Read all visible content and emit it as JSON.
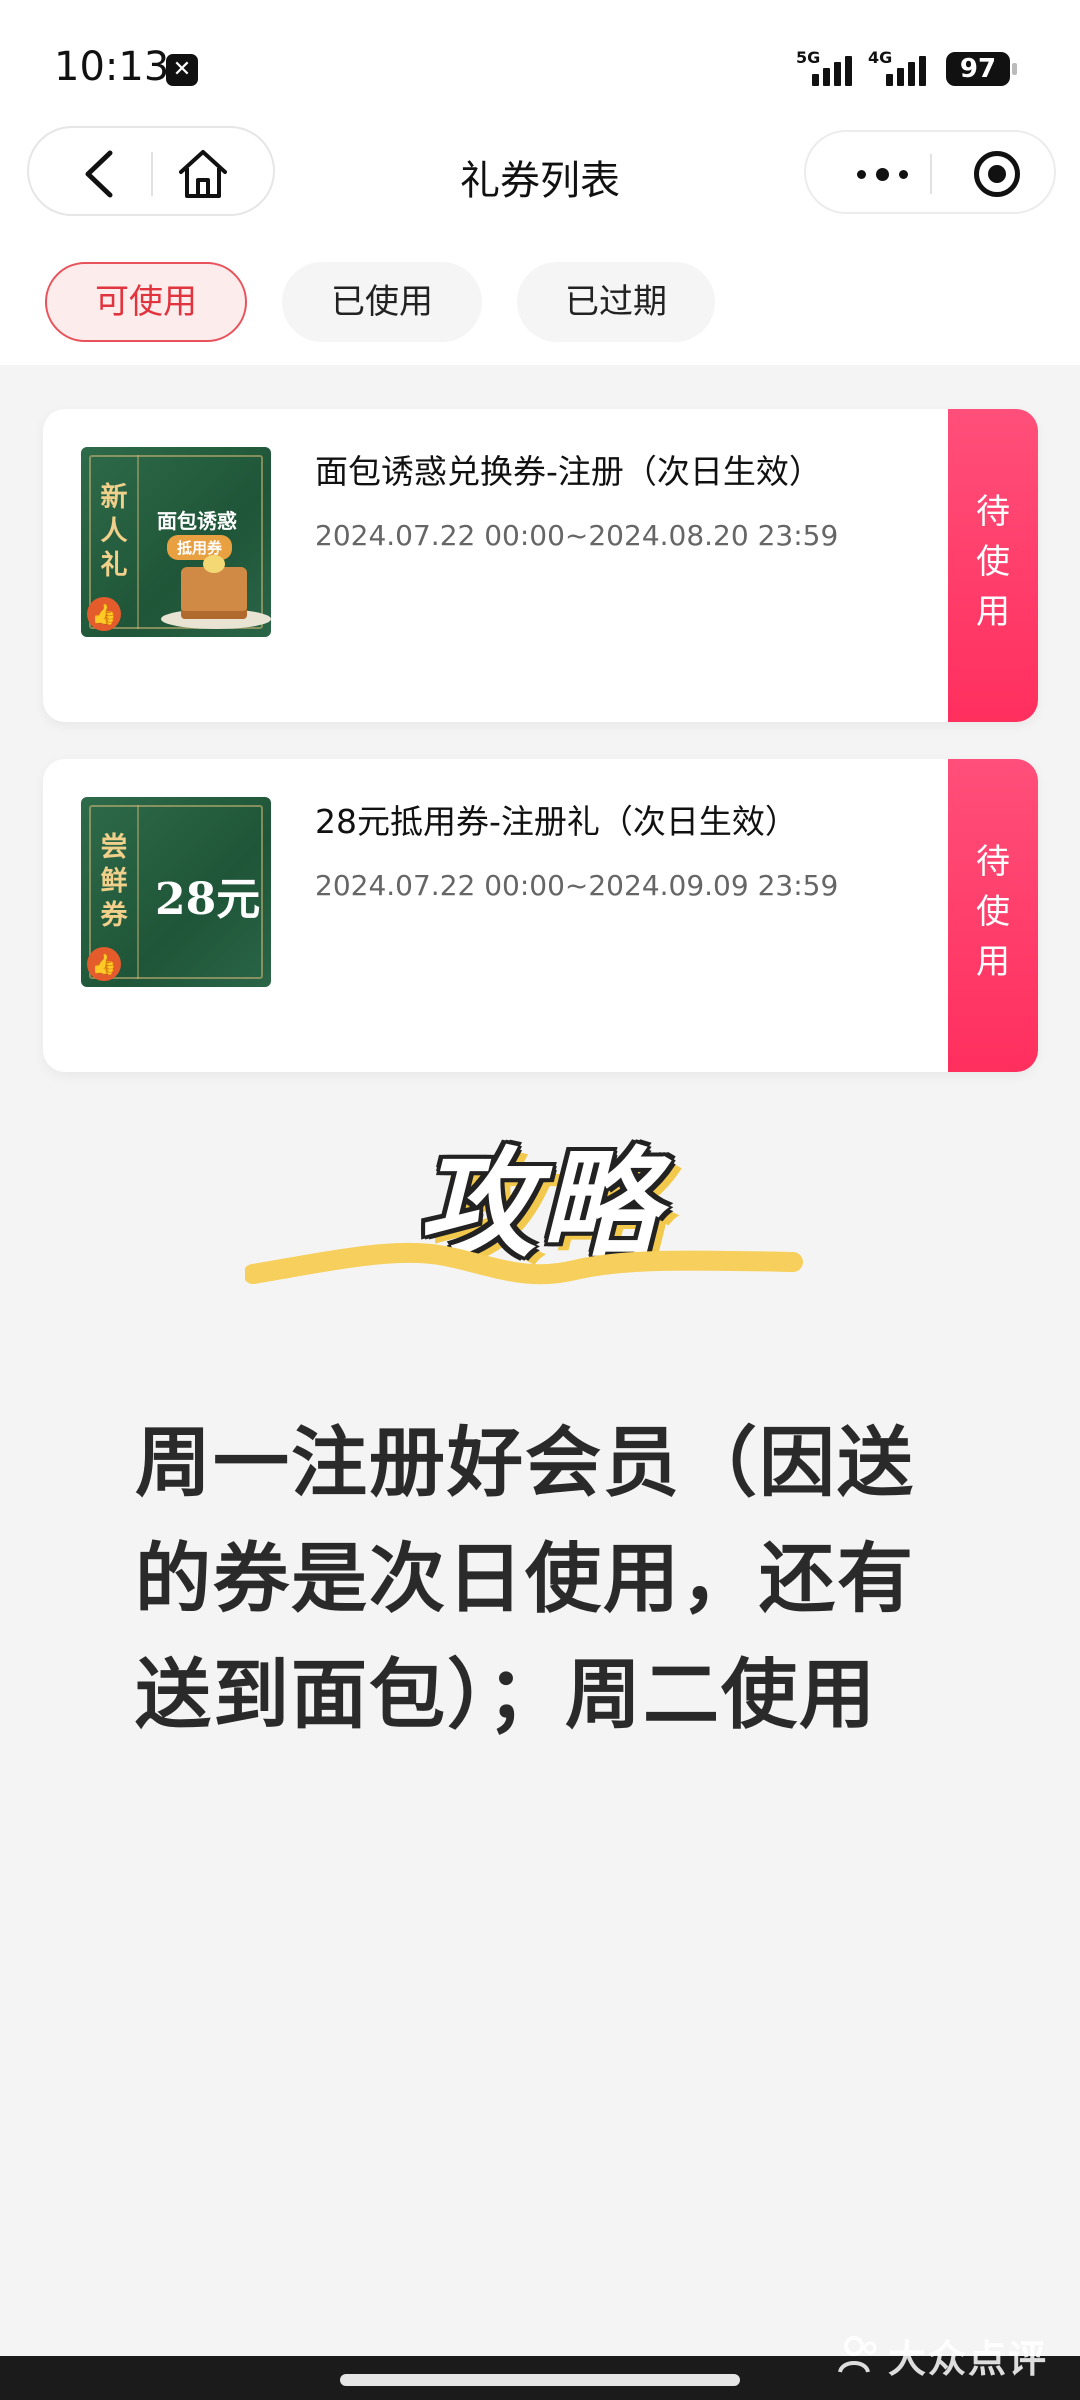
{
  "status_bar": {
    "time": "10:13",
    "app_badge": "✕",
    "sig1": "5G",
    "sig2": "4G",
    "battery": "97"
  },
  "nav": {
    "title": "礼券列表"
  },
  "tabs": [
    {
      "label": "可使用",
      "active": true
    },
    {
      "label": "已使用",
      "active": false
    },
    {
      "label": "已过期",
      "active": false
    }
  ],
  "coupons": [
    {
      "name": "面包诱惑兑换券-注册（次日生效）",
      "date": "2024.07.22 00:00~2024.08.20 23:59",
      "status": [
        "待",
        "使",
        "用"
      ],
      "image": {
        "vertical_text": [
          "新",
          "人",
          "礼"
        ],
        "title": "面包诱惑",
        "subtitle": "抵用券"
      }
    },
    {
      "name": "28元抵用券-注册礼（次日生效）",
      "date": "2024.07.22 00:00~2024.09.09 23:59",
      "status": [
        "待",
        "使",
        "用"
      ],
      "image": {
        "vertical_text": [
          "尝",
          "鲜",
          "券"
        ],
        "title": "28元"
      }
    }
  ],
  "strategy": {
    "title": "攻略",
    "text": "周一注册好会员（因送的券是次日使用，还有送到面包）；周二使用"
  },
  "watermark": "大众点评",
  "colors": {
    "accent": "#ff3a64",
    "tab_active": "#e0343e",
    "coupon_green": "#1f5538",
    "highlight": "#f2c94c"
  }
}
